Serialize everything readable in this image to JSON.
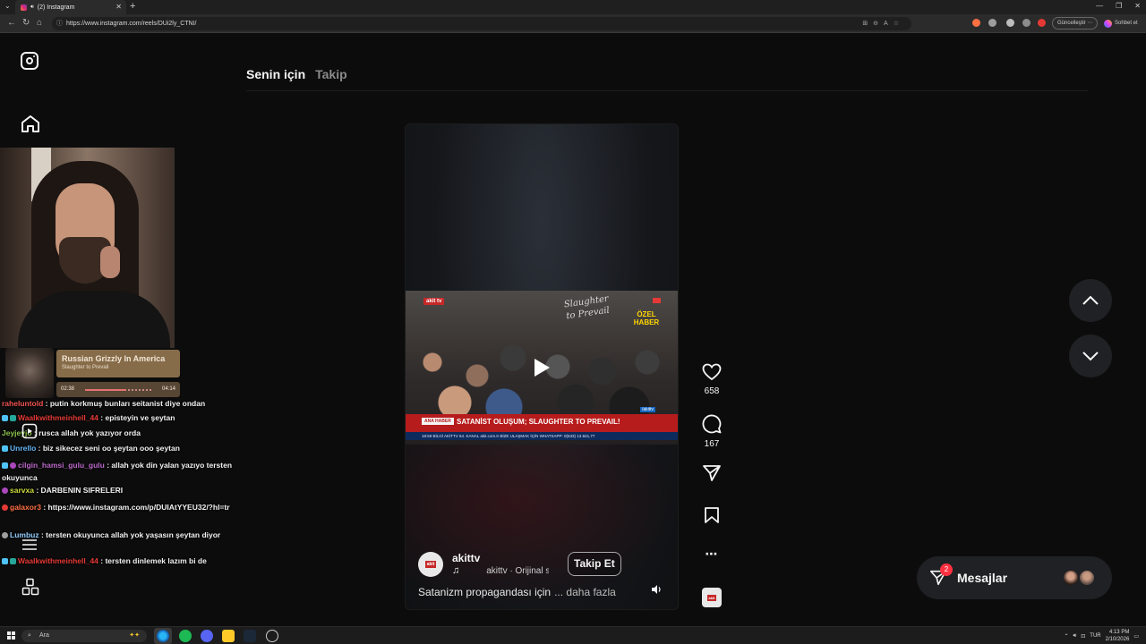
{
  "browser": {
    "tab_title": "(2) Instagram",
    "url": "https://www.instagram.com/reels/DUi2ly_CTNI/",
    "update_label": "Güncelleştir",
    "chat_label": "Sohbet et"
  },
  "feed": {
    "tabs": [
      "Senin için",
      "Takip"
    ]
  },
  "reel": {
    "video": {
      "tv_logo": "akit tv",
      "ozel_haber": "ÖZEL HABER",
      "tag": "ANA HABER",
      "headline": "SATANİST OLUŞUM; SLAUGHTER TO PREVAIL!",
      "facebook_tag": "/akittv",
      "ticker": "18:59   BİLGİ   AKİTTV 64. KANAL   akit.com.tr   BİZE ULAŞMAK İÇİN WHATSAPP: 0(533)   13.841,77"
    },
    "username": "akittv",
    "audio": "akittv · Orijinal ses",
    "follow_label": "Takip Et",
    "caption": "Satanizm propagandası için",
    "caption_more": "... daha fazla",
    "likes": "658",
    "comments": "167"
  },
  "messages": {
    "label": "Mesajlar",
    "badge": "2"
  },
  "stream": {
    "now_playing": {
      "title": "Russian Grizzly In America",
      "artist": "Slaughter to Prevail",
      "elapsed": "02:38",
      "duration": "04:14",
      "progress": 0.62
    },
    "chat": [
      {
        "user": "raheluntold",
        "color": "#ef5350",
        "text": " : putin korkmuş bunları seitanist diye ondan",
        "badges": []
      },
      {
        "user": "Waalkwithmeinhell_44",
        "color": "#e53935",
        "text": " : episteyin ve şeytan",
        "badges": [
          "b-blue",
          "b-teal"
        ]
      },
      {
        "user": "Jeyjeyjo",
        "color": "#8bc34a",
        "text": " : rusca allah yok yazıyor orda",
        "badges": []
      },
      {
        "user": "Unrello",
        "color": "#64b5f6",
        "text": " : biz sikecez seni oo şeytan ooo şeytan",
        "badges": [
          "b-blue"
        ]
      },
      {
        "user": "cilgin_hamsi_gulu_gulu",
        "color": "#ba68c8",
        "text": " : allah yok din yalan yazıyo tersten okuyunca",
        "badges": [
          "b-blue",
          "b-purple"
        ]
      },
      {
        "user": "sarvxa",
        "color": "#cddc39",
        "text": " : DARBENIN SIFRELERI",
        "badges": [
          "b-purple"
        ]
      },
      {
        "user": "galaxor3",
        "color": "#ff7043",
        "text": " : https://www.instagram.com/p/DUIAtYYEU32/?hl=tr",
        "badges": [
          "b-red"
        ]
      },
      {
        "user": "Lumbuz",
        "color": "#90caf9",
        "text": " : tersten okuyunca allah yok yaşasın şeytan diyor",
        "badges": [
          "b-grey"
        ]
      },
      {
        "user": "Waalkwithmeinhell_44",
        "color": "#e53935",
        "text": " : tersten dinlemek lazım bi de",
        "badges": [
          "b-blue",
          "b-teal"
        ]
      }
    ]
  },
  "taskbar": {
    "search_placeholder": "Ara",
    "lang": "TUR",
    "time": "4:13 PM",
    "date": "2/10/2026"
  }
}
